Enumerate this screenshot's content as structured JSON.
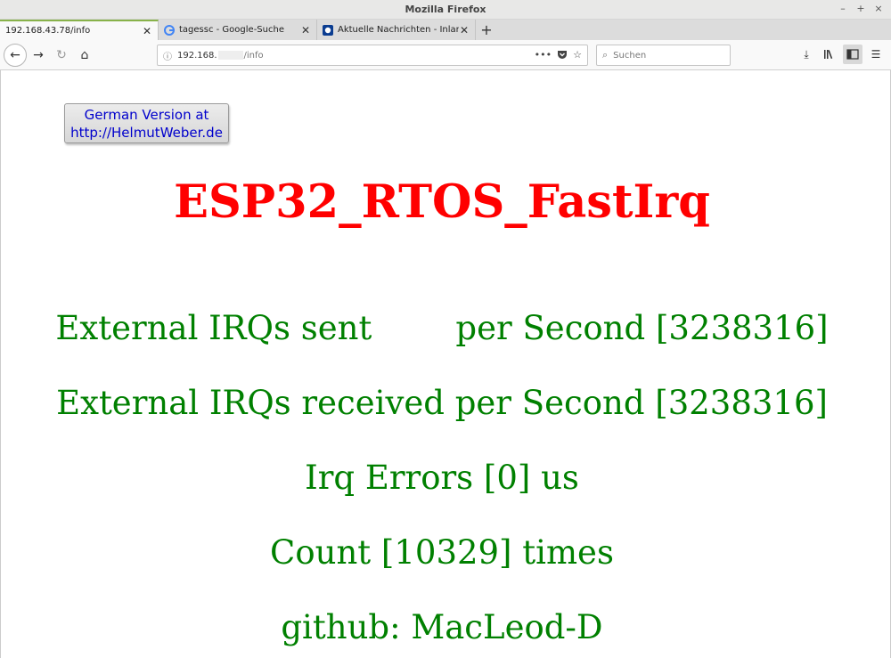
{
  "window": {
    "title": "Mozilla Firefox",
    "controls": [
      "–",
      "+",
      "×"
    ]
  },
  "tabs": [
    {
      "label": "192.168.43.78/info",
      "close": "✕"
    },
    {
      "label": "tagessc - Google-Suche",
      "close": "✕"
    },
    {
      "label": "Aktuelle Nachrichten - Inland",
      "close": "✕"
    }
  ],
  "new_tab": "+",
  "nav": {
    "url_host": "192.168.",
    "url_path": "/info",
    "search_placeholder": "Suchen",
    "icons": [
      "back-icon",
      "forward-icon",
      "reload-icon",
      "home-icon",
      "info-icon",
      "more-icon",
      "pocket-icon",
      "bookmark-star-icon",
      "search-icon",
      "download-icon",
      "library-icon",
      "sidebar-icon",
      "menu-icon"
    ]
  },
  "page": {
    "german_button_line1": "German Version at",
    "german_button_line2": "http://HelmutWeber.de",
    "heading": "ESP32_RTOS_FastIrq",
    "line1": "External IRQs sent        per Second [3238316]",
    "line2": "External IRQs received per Second [3238316]",
    "line3": "Irq Errors [0] us",
    "line4": "Count [10329] times",
    "line5": "github: MacLeod-D"
  },
  "colors": {
    "heading": "#ff0000",
    "body_text": "#008000",
    "link": "#0000cc",
    "active_tab_accent": "#88b24a"
  }
}
